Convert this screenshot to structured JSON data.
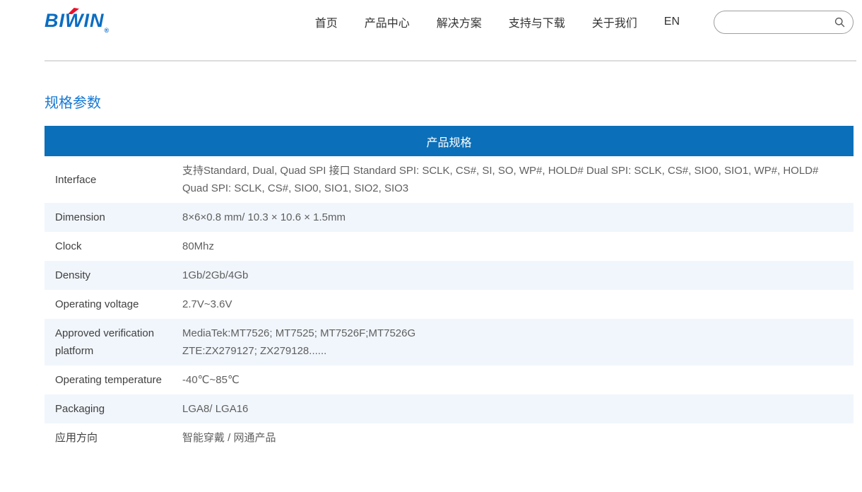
{
  "brand": {
    "name": "BIWIN",
    "registered": "®",
    "logo_blue": "#0a6dc2",
    "logo_red": "#e8112d"
  },
  "nav": {
    "items": [
      "首页",
      "产品中心",
      "解决方案",
      "支持与下载",
      "关于我们"
    ],
    "lang": "EN"
  },
  "search": {
    "placeholder": "",
    "value": ""
  },
  "page": {
    "section_title": "规格参数"
  },
  "spec_table": {
    "header": "产品规格",
    "rows": [
      {
        "label": "Interface",
        "value": "支持Standard, Dual, Quad SPI 接口 Standard SPI: SCLK, CS#, SI, SO, WP#, HOLD# Dual SPI: SCLK, CS#, SIO0, SIO1, WP#, HOLD# Quad SPI: SCLK, CS#, SIO0, SIO1, SIO2, SIO3"
      },
      {
        "label": "Dimension",
        "value": "8×6×0.8 mm/ 10.3 × 10.6 × 1.5mm"
      },
      {
        "label": "Clock",
        "value": "80Mhz"
      },
      {
        "label": "Density",
        "value": "1Gb/2Gb/4Gb"
      },
      {
        "label": "Operating voltage",
        "value": "2.7V~3.6V"
      },
      {
        "label": "Approved verification platform",
        "lines": [
          "MediaTek:MT7526; MT7525; MT7526F;MT7526G",
          "ZTE:ZX279127; ZX279128......"
        ]
      },
      {
        "label": "Operating temperature",
        "value": "-40℃~85℃"
      },
      {
        "label": "Packaging",
        "value": "LGA8/ LGA16"
      },
      {
        "label": "应用方向",
        "value": "智能穿戴 / 网通产品"
      }
    ]
  },
  "colors": {
    "table_header_bg": "#0b70b9",
    "row_alt_bg": "#f1f6fc",
    "section_title": "#1678d3",
    "divider": "#dcdcdc"
  }
}
